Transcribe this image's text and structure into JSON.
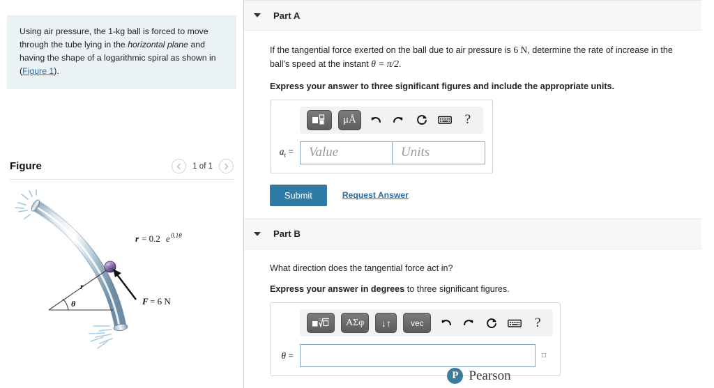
{
  "problem": {
    "text_before_em": "Using air pressure, the 1-kg ball is forced to move through the tube lying in the ",
    "emphasis": "horizontal plane",
    "text_after_em": " and having the shape of a logarithmic spiral as shown in (",
    "figure_link": "Figure 1",
    "text_end": ")."
  },
  "figure": {
    "title": "Figure",
    "counter": "1 of 1",
    "prev_icon": "chevron-left-icon",
    "next_icon": "chevron-right-icon",
    "labels": {
      "spiral_equation_r": "r",
      "spiral_equation_eq": "= 0.2",
      "spiral_equation_base": "e",
      "spiral_equation_exp": "0.1θ",
      "radius_label": "r",
      "angle_label": "θ",
      "force_label_f": "F",
      "force_label_value": "= 6 N"
    }
  },
  "partA": {
    "title": "Part A",
    "caret_icon": "chevron-down-icon",
    "question_start": "If the tangential force exerted on the ball due to air pressure is ",
    "question_force": "6 N",
    "question_mid": ", determine the rate of increase in the ball's speed at the instant ",
    "question_theta": "θ = π/2",
    "question_end": ".",
    "instruction": "Express your answer to three significant figures and include the appropriate units.",
    "toolbar": {
      "template_button": "template-icon",
      "units_button": "μÅ",
      "undo_icon": "undo-arrow-icon",
      "redo_icon": "redo-arrow-icon",
      "reset_icon": "reset-circle-icon",
      "keyboard_icon": "keyboard-icon",
      "help_icon": "?"
    },
    "answer_label_base": "a",
    "answer_label_sub": "t",
    "answer_label_eq": "=",
    "value_placeholder": "Value",
    "units_placeholder": "Units",
    "value_current": "",
    "units_current": "",
    "submit_label": "Submit",
    "request_answer_label": "Request Answer"
  },
  "partB": {
    "title": "Part B",
    "caret_icon": "chevron-down-icon",
    "question": "What direction does the tangential force act in?",
    "instruction_bold": "Express your answer in degrees",
    "instruction_regular": " to three significant figures.",
    "toolbar": {
      "radical_button": "radical-template-icon",
      "greek_button": "ΑΣφ",
      "arrows_button": "↓↑",
      "vector_button": "vec",
      "undo_icon": "undo-arrow-icon",
      "redo_icon": "redo-arrow-icon",
      "reset_icon": "reset-circle-icon",
      "keyboard_icon": "keyboard-icon",
      "help_icon": "?"
    },
    "answer_label": "θ",
    "answer_label_eq": "=",
    "answer_current": "",
    "degree_symbol": "□"
  },
  "footer": {
    "brand_mark": "P",
    "brand_name": "Pearson"
  },
  "colors": {
    "problem_bg": "#eaf2f5",
    "part_header_bg": "#f7f7f7",
    "submit_blue": "#2e7ba6",
    "link_blue": "#2b6ca3",
    "input_border": "#7fa8bd",
    "pearson_teal": "#3b7d9e"
  }
}
